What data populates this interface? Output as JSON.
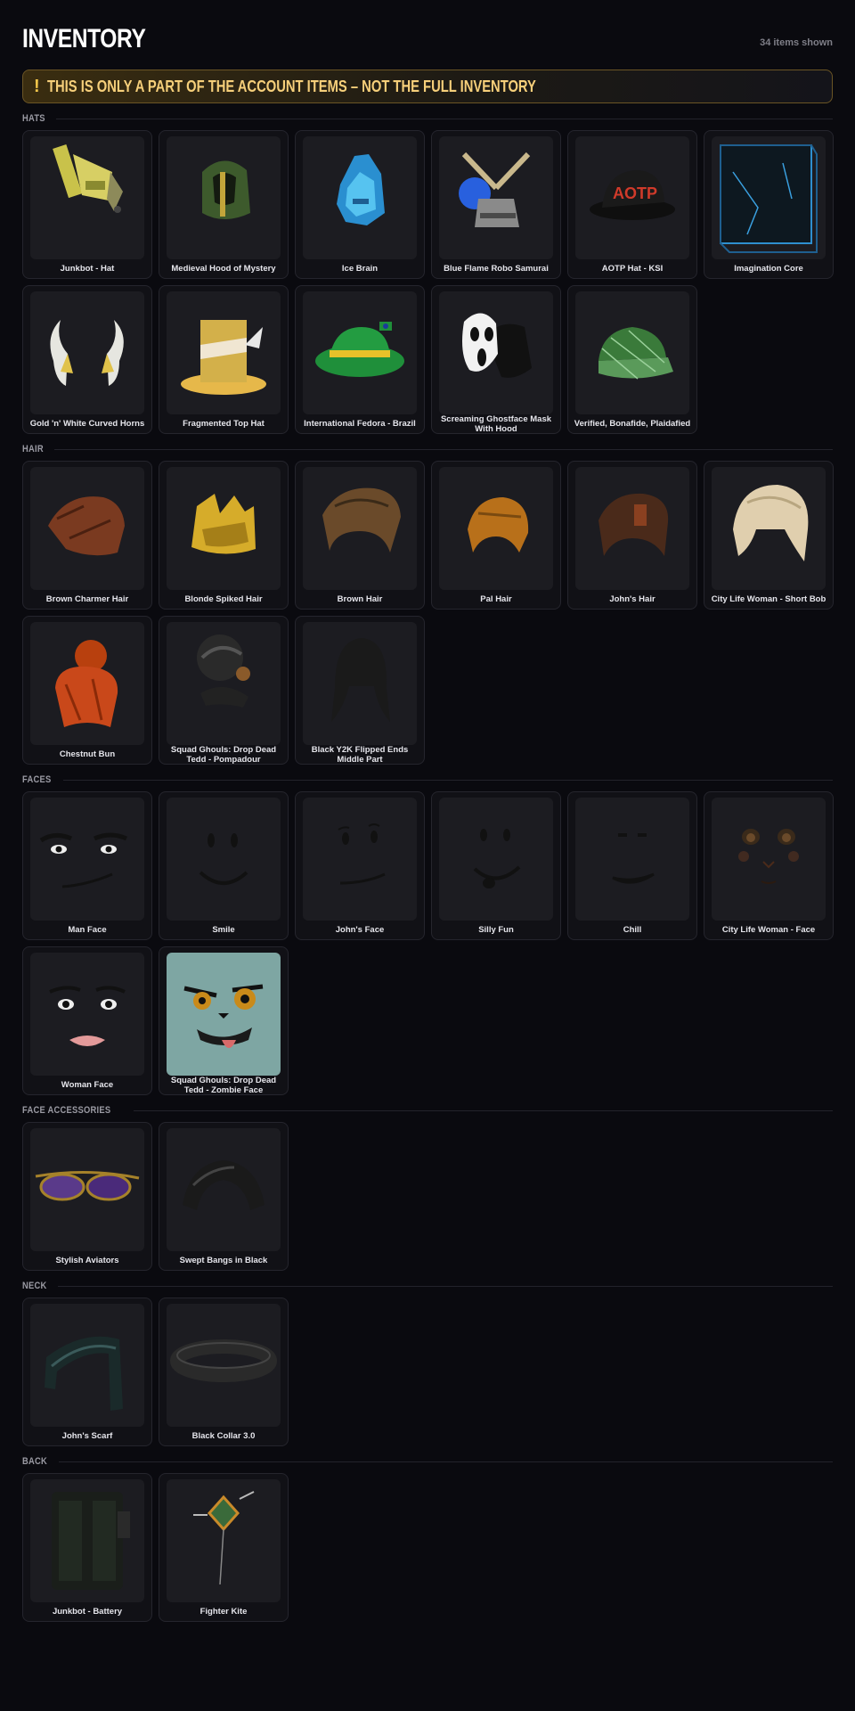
{
  "title": "INVENTORY",
  "count": "34 items shown",
  "banner": {
    "icon": "!",
    "text": "THIS IS ONLY A PART OF THE ACCOUNT ITEMS – NOT THE FULL INVENTORY"
  },
  "sections": [
    {
      "title": "HATS",
      "items": [
        {
          "name": "Junkbot - Hat",
          "icon": "junkbot-hat-icon"
        },
        {
          "name": "Medieval Hood of Mystery",
          "icon": "medieval-hood-icon"
        },
        {
          "name": "Ice Brain",
          "icon": "ice-brain-icon"
        },
        {
          "name": "Blue Flame Robo Samurai",
          "icon": "samurai-icon"
        },
        {
          "name": "AOTP Hat - KSI",
          "icon": "aotp-hat-icon",
          "print": "AOTP"
        },
        {
          "name": "Imagination Core",
          "icon": "cube-icon"
        },
        {
          "name": "Gold 'n' White Curved Horns",
          "icon": "horns-icon"
        },
        {
          "name": "Fragmented Top Hat",
          "icon": "top-hat-icon"
        },
        {
          "name": "International Fedora - Brazil",
          "icon": "fedora-icon"
        },
        {
          "name": "Screaming Ghostface Mask With Hood",
          "icon": "ghostface-mask-icon"
        },
        {
          "name": "Verified, Bonafide, Plaidafied",
          "icon": "plaid-cap-icon"
        }
      ]
    },
    {
      "title": "HAIR",
      "items": [
        {
          "name": "Brown Charmer Hair",
          "icon": "hair-icon"
        },
        {
          "name": "Blonde Spiked Hair",
          "icon": "hair-icon"
        },
        {
          "name": "Brown Hair",
          "icon": "hair-icon"
        },
        {
          "name": "Pal Hair",
          "icon": "hair-icon"
        },
        {
          "name": "John's Hair",
          "icon": "hair-icon"
        },
        {
          "name": "City Life Woman - Short Bob",
          "icon": "hair-icon"
        },
        {
          "name": "Chestnut Bun",
          "icon": "hair-icon"
        },
        {
          "name": "Squad Ghouls: Drop Dead Tedd - Pompadour",
          "icon": "pompadour-icon"
        },
        {
          "name": "Black Y2K Flipped Ends Middle Part",
          "icon": "hair-icon"
        }
      ]
    },
    {
      "title": "FACES",
      "items": [
        {
          "name": "Man Face",
          "icon": "face-icon"
        },
        {
          "name": "Smile",
          "icon": "face-icon"
        },
        {
          "name": "John's Face",
          "icon": "face-icon"
        },
        {
          "name": "Silly Fun",
          "icon": "face-icon"
        },
        {
          "name": "Chill",
          "icon": "face-icon"
        },
        {
          "name": "City Life Woman - Face",
          "icon": "face-icon"
        },
        {
          "name": "Woman Face",
          "icon": "face-icon"
        },
        {
          "name": "Squad Ghouls: Drop Dead Tedd - Zombie Face",
          "icon": "zombie-face-icon"
        }
      ]
    },
    {
      "title": "FACE ACCESSORIES",
      "items": [
        {
          "name": "Stylish Aviators",
          "icon": "aviators-icon"
        },
        {
          "name": "Swept Bangs in Black",
          "icon": "bangs-icon"
        }
      ]
    },
    {
      "title": "NECK",
      "items": [
        {
          "name": "John's Scarf",
          "icon": "scarf-icon"
        },
        {
          "name": "Black Collar 3.0",
          "icon": "collar-icon"
        }
      ]
    },
    {
      "title": "BACK",
      "items": [
        {
          "name": "Junkbot - Battery",
          "icon": "battery-icon"
        },
        {
          "name": "Fighter Kite",
          "icon": "kite-icon"
        }
      ]
    }
  ]
}
